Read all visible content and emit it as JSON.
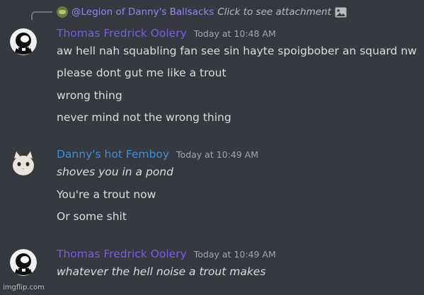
{
  "reply": {
    "mention": "@Legion of Danny's Ballsacks",
    "click_text": "Click to see attachment"
  },
  "messages": [
    {
      "username": "Thomas Fredrick Oolery",
      "timestamp": "Today at 10:48 AM",
      "lines": [
        "aw hell nah squabling fan see sin hayte spoigbober an squard nw",
        "please dont gut me like a trout",
        "wrong thing",
        "never mind not the wrong thing"
      ]
    },
    {
      "username": "Danny's hot Femboy",
      "timestamp": "Today at 10:49 AM",
      "lines": [
        "shoves you in a pond",
        "You're a trout now",
        "Or some shit"
      ]
    },
    {
      "username": "Thomas Fredrick Oolery",
      "timestamp": "Today at 10:49 AM",
      "lines": [
        "whatever the hell noise a trout makes"
      ]
    }
  ],
  "watermark": "imgflip.com",
  "colors": {
    "background": "#36393f",
    "username_purple": "#7d5ce0",
    "username_blue": "#3f8fd8",
    "text": "#dcddde",
    "timestamp": "#a3a6aa"
  },
  "icons": {
    "reply_avatar": "mini-avatar-icon",
    "attachment": "image-icon"
  }
}
